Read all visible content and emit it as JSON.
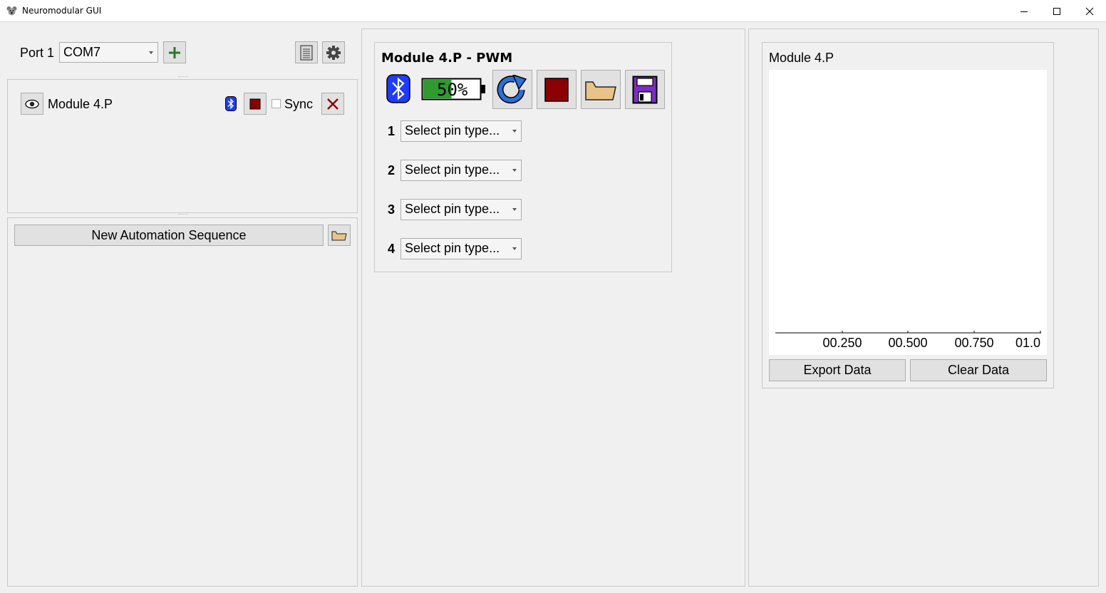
{
  "window": {
    "title": "Neuromodular GUI",
    "icon": "koala-app-icon",
    "controls": [
      "minimize-icon",
      "maximize-icon",
      "close-icon"
    ]
  },
  "left_panel": {
    "port": {
      "label": "Port 1",
      "selected": "COM7"
    },
    "toolbar_icons": [
      "add-port-icon",
      "list-icon",
      "gear-icon"
    ],
    "module": {
      "name": "Module 4.P",
      "sync_label": "Sync",
      "sync_checked": false
    },
    "automation": {
      "button_label": "New Automation Sequence"
    }
  },
  "module_panel": {
    "title": "Module 4.P - PWM",
    "battery_percent": 50,
    "battery_text": "50%",
    "toolbar_icons": [
      "bluetooth-icon",
      "battery-icon",
      "refresh-icon",
      "stop-icon",
      "folder-icon",
      "save-icon"
    ],
    "pins": [
      {
        "number": "1",
        "value": "Select pin type..."
      },
      {
        "number": "2",
        "value": "Select pin type..."
      },
      {
        "number": "3",
        "value": "Select pin type..."
      },
      {
        "number": "4",
        "value": "Select pin type..."
      }
    ]
  },
  "plot_panel": {
    "title": "Module 4.P",
    "export_label": "Export Data",
    "clear_label": "Clear Data",
    "x_ticks": [
      "00.250",
      "00.500",
      "00.750",
      "01.0"
    ]
  },
  "colors": {
    "bluetooth": "#1e3cff",
    "battery_fill": "#2e9b2e",
    "stop": "#8b0000",
    "folder": "#e8c48a",
    "save": "#7b2fbe",
    "refresh": "#2a6fd6"
  }
}
